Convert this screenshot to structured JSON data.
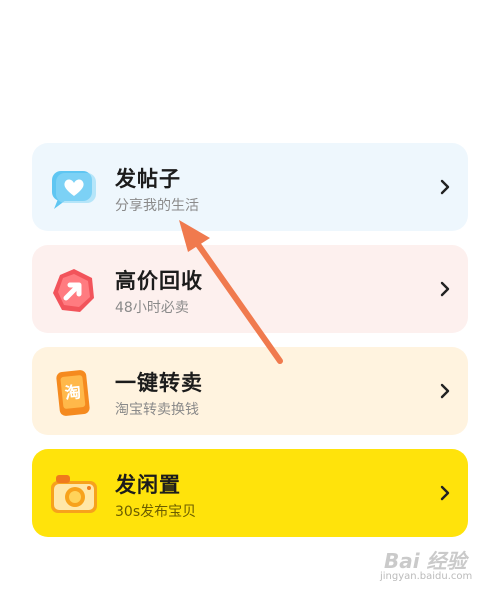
{
  "menu": {
    "items": [
      {
        "title": "发帖子",
        "subtitle": "分享我的生活",
        "icon": "chat-heart-icon"
      },
      {
        "title": "高价回收",
        "subtitle": "48小时必卖",
        "icon": "recycle-arrow-icon"
      },
      {
        "title": "一键转卖",
        "subtitle": "淘宝转卖换钱",
        "icon": "taobao-phone-icon",
        "icon_text": "淘"
      },
      {
        "title": "发闲置",
        "subtitle": "30s发布宝贝",
        "icon": "camera-icon"
      }
    ]
  },
  "colors": {
    "card1": "#eef7fd",
    "card2": "#fdf0ee",
    "card3": "#fff3df",
    "card4": "#ffe30b",
    "arrow": "#f07a4e"
  },
  "watermark": {
    "text": "Bai 经验",
    "sub": "jingyan.baidu.com"
  }
}
